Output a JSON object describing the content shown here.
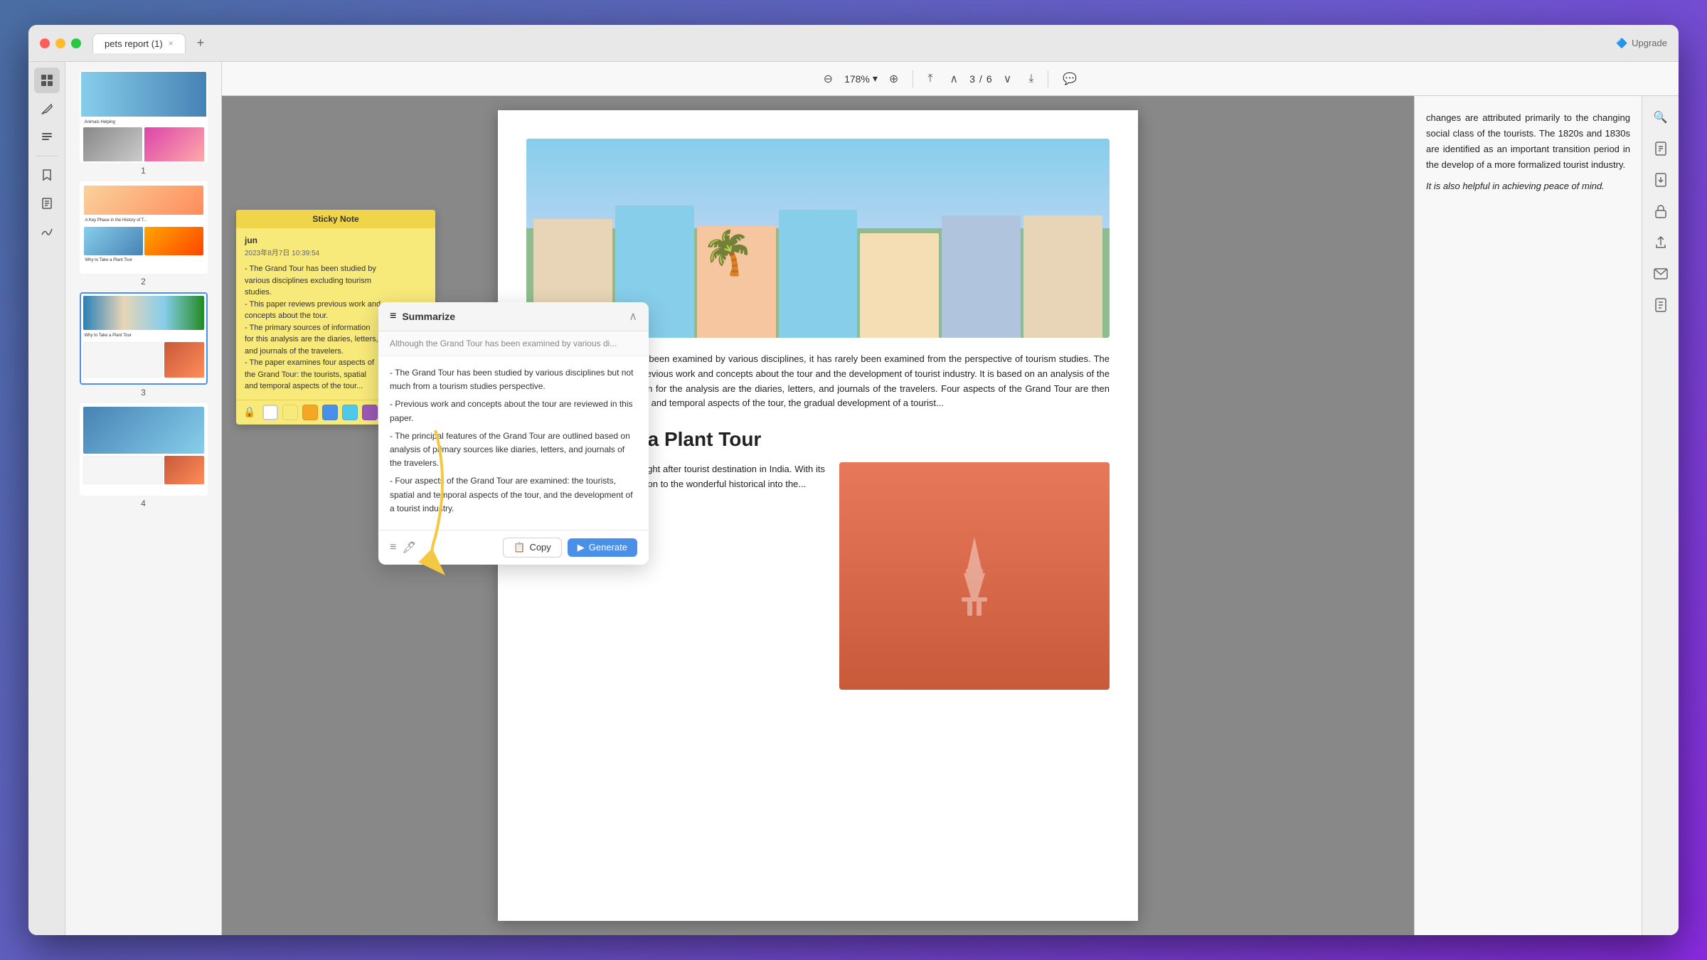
{
  "window": {
    "title": "pets report (1)",
    "tab_close": "×",
    "tab_add": "+",
    "upgrade_label": "Upgrade"
  },
  "toolbar": {
    "zoom_level": "178%",
    "zoom_out_label": "−",
    "zoom_in_label": "+",
    "page_current": "3",
    "page_separator": "/",
    "page_total": "6"
  },
  "thumbnails": [
    {
      "page_num": "1",
      "selected": false
    },
    {
      "page_num": "2",
      "selected": false
    },
    {
      "page_num": "3",
      "selected": true
    },
    {
      "page_num": "4",
      "selected": false
    }
  ],
  "right_panel": {
    "text_1": "changes are attributed primarily to the changing social class of the tourists. The 1820s and 1830s are identified as an important transition period in the develop of a more formalized tourist industry.",
    "text_2": "It is also helpful in achieving peace of mind."
  },
  "sticky_note": {
    "header": "Sticky Note",
    "author": "jun",
    "date": "2023年8月7日 10:39:54",
    "content": "- The Grand Tour has been studied by various disciplines excluding tourism studies.\n- This paper reviews previous work and concepts about the tour.\n- The primary sources of information for this analysis are the diaries, letters, and journals of the travelers.\n- The paper examines four aspects of the Grand Tour: the tourists, spatial and temporal aspects of the tour...",
    "colors": [
      "#ffffff",
      "#f7e97a",
      "#f5a623",
      "#4a8fe8",
      "#50c8e8",
      "#9b59b6",
      "#e74c3c"
    ]
  },
  "summarize": {
    "header": "Summarize",
    "header_icon": "≡",
    "close_icon": "∧",
    "preview_text": "Although the Grand Tour has been examined by various di...",
    "bullets": [
      "- The Grand Tour has been studied by various disciplines but not much from a tourism studies perspective.",
      "- Previous work and concepts about the tour are reviewed in this paper.",
      "- The principal features of the Grand Tour are outlined based on analysis of primary sources like diaries, letters, and journals of the travelers.",
      "- Four aspects of the Grand Tour are examined: the tourists, spatial and temporal aspects of the tour, and the development of a tourist industry."
    ],
    "copy_label": "Copy",
    "generate_label": "Generate"
  },
  "pdf_content": {
    "body_text_1": "Although the Grand Tour has been examined by various disciplines, it has rarely been examined from the perspective of tourism studies. The paper presents a review of previous work and concepts about the tour and the development of tourist industry. It is based on an analysis of the primary sources of information for the analysis are the diaries, letters, and journals of the travelers. Four aspects of the Grand Tour are then examined: the tourists, spatial and temporal aspects of the tour, the gradual development of a tourist...",
    "section_title": "Why to Take a Plant Tour",
    "body_text_2": "the royal land is the most sought after tourist destination in India. With its historical cities and the attention to the wonderful historical into the..."
  }
}
